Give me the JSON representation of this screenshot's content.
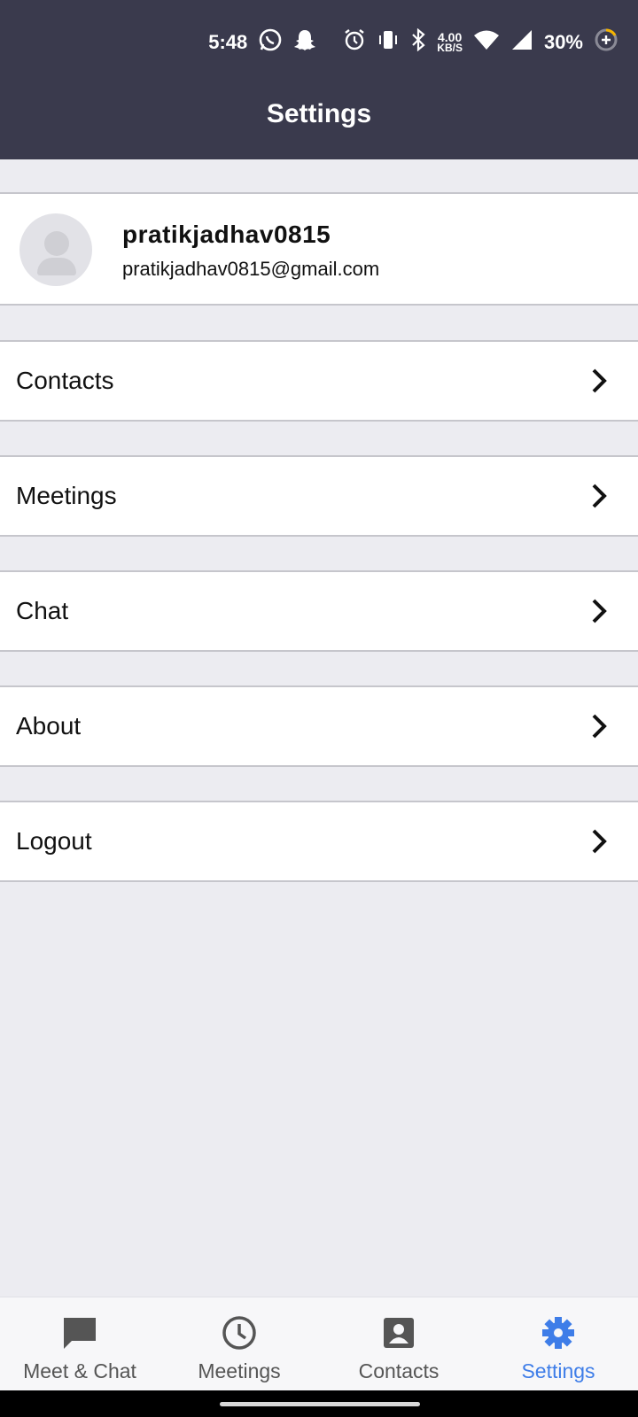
{
  "status_bar": {
    "time": "5:48",
    "speed_value": "4.00",
    "speed_unit": "KB/S",
    "battery": "30%",
    "icons": [
      "whatsapp-icon",
      "snapchat-icon",
      "alarm-icon",
      "vibrate-icon",
      "bluetooth-icon",
      "wifi-icon",
      "signal-icon",
      "battery-saver-icon"
    ]
  },
  "header": {
    "title": "Settings"
  },
  "profile": {
    "username": "pratikjadhav0815",
    "email": "pratikjadhav0815@gmail.com"
  },
  "menu": [
    {
      "label": "Contacts"
    },
    {
      "label": "Meetings"
    },
    {
      "label": "Chat"
    },
    {
      "label": "About"
    },
    {
      "label": "Logout"
    }
  ],
  "bottom_nav": {
    "active": "Settings",
    "active_color": "#3e7de8",
    "tabs": [
      {
        "label": "Meet & Chat",
        "icon": "chat-bubble-icon"
      },
      {
        "label": "Meetings",
        "icon": "clock-icon"
      },
      {
        "label": "Contacts",
        "icon": "contact-card-icon"
      },
      {
        "label": "Settings",
        "icon": "gear-icon"
      }
    ]
  },
  "colors": {
    "header_bg": "#3a3a4d",
    "page_bg": "#ececf1"
  }
}
